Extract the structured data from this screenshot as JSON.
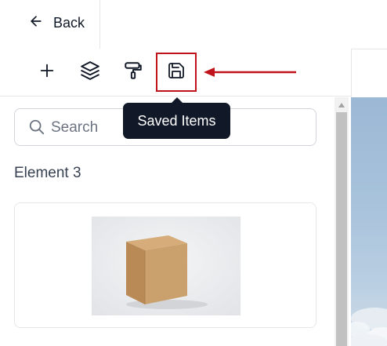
{
  "header": {
    "back_label": "Back"
  },
  "toolbar": {
    "buttons": [
      {
        "name": "add",
        "icon": "plus-icon"
      },
      {
        "name": "layers",
        "icon": "layers-icon"
      },
      {
        "name": "styles",
        "icon": "paint-roller-icon"
      },
      {
        "name": "saved-items",
        "icon": "save-icon"
      }
    ],
    "tooltip": "Saved Items",
    "highlight_color": "#c0121b"
  },
  "search": {
    "placeholder": "Search"
  },
  "section": {
    "heading": "Element 3"
  },
  "item_card": {
    "image_icon": "cardboard-box-image"
  },
  "colors": {
    "tooltip_bg": "#111827",
    "border": "#e5e7eb",
    "annotation_red": "#c0121b"
  }
}
